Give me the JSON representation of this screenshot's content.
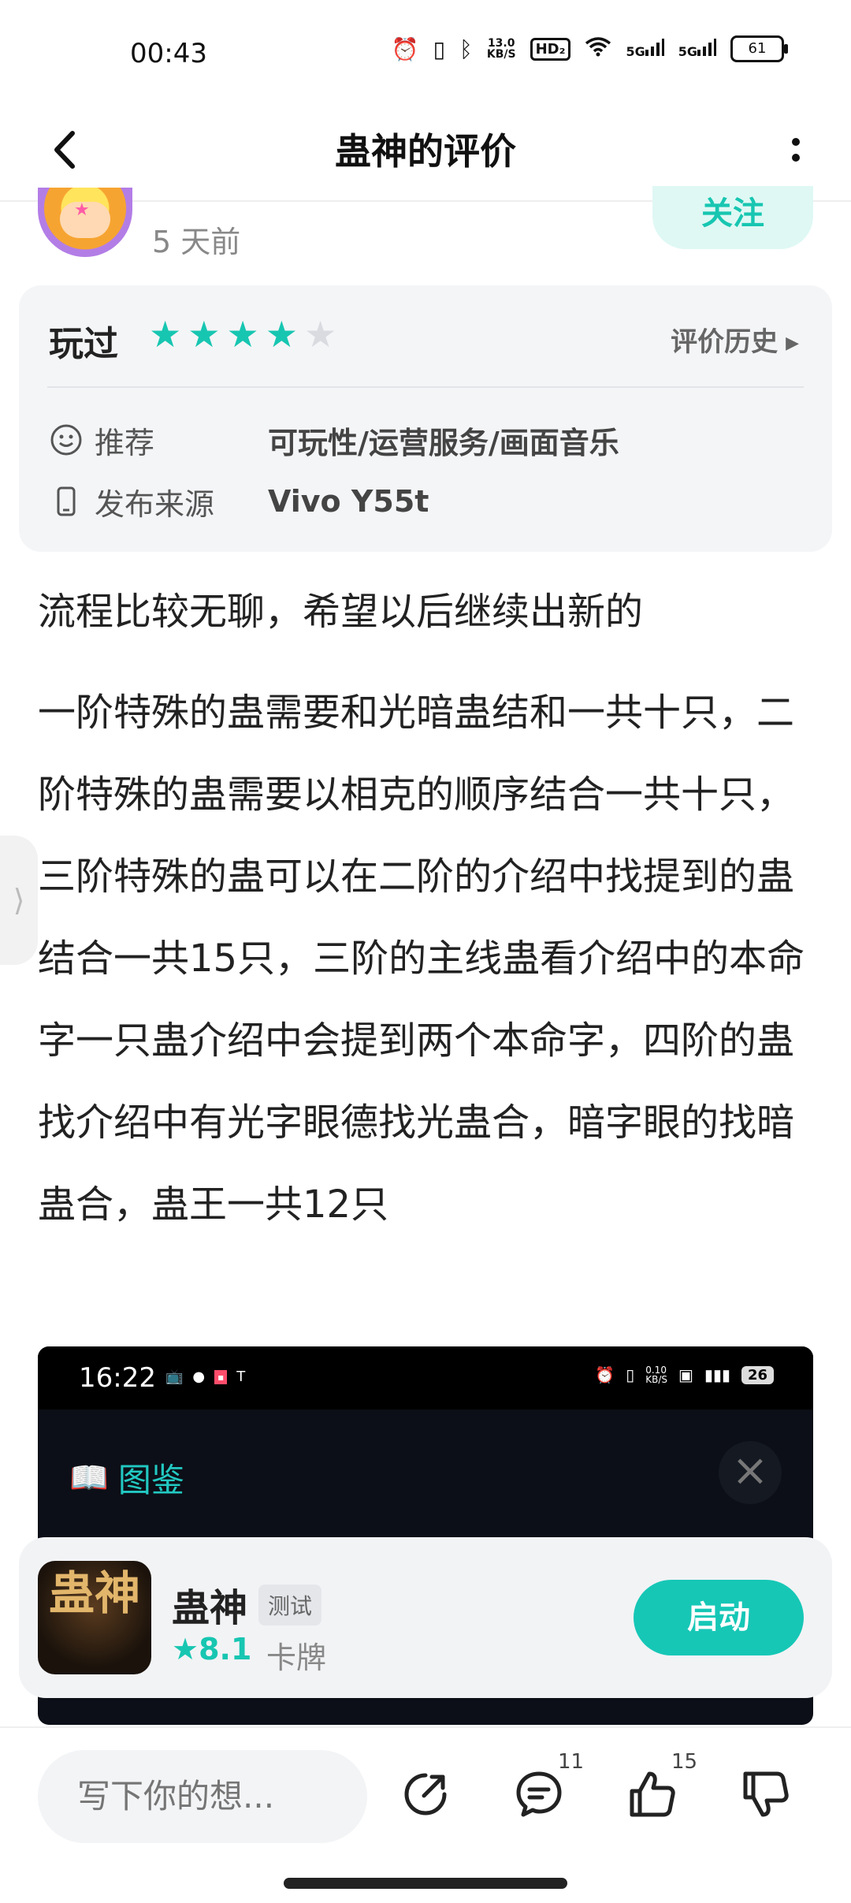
{
  "status_bar": {
    "time": "00:43",
    "net_speed": "13.0\nKB/S",
    "hd_badge": "HD₂",
    "signal1": "5G",
    "signal2": "5G",
    "battery": "61"
  },
  "header": {
    "title": "蛊神的评价"
  },
  "author": {
    "posted_time": "5 天前",
    "follow_label": "关注"
  },
  "rating": {
    "status_label": "玩过",
    "stars": 4,
    "max_stars": 5,
    "history_label": "评价历史",
    "recommend_label": "推荐",
    "recommend_value": "可玩性/运营服务/画面音乐",
    "source_label": "发布来源",
    "source_value": "Vivo Y55t"
  },
  "review": {
    "paragraph1": "流程比较无聊，希望以后继续出新的",
    "paragraph2": "一阶特殊的蛊需要和光暗蛊结和一共十只，二阶特殊的蛊需要以相克的顺序结合一共十只，三阶特殊的蛊可以在二阶的介绍中找提到的蛊结合一共15只，三阶的主线蛊看介绍中的本命字一只蛊介绍中会提到两个本命字，四阶的蛊找介绍中有光字眼德找光蛊合，暗字眼的找暗蛊合，蛊王一共12只"
  },
  "screenshot": {
    "time": "16:22",
    "title": "图鉴",
    "speed": "0.10\nKB/S",
    "battery": "26"
  },
  "game": {
    "icon_text": "蛊神",
    "name": "蛊神",
    "badge": "测试",
    "rating": "8.1",
    "genre": "卡牌",
    "launch_label": "启动"
  },
  "bottom_bar": {
    "input_placeholder": "写下你的想...",
    "comment_count": "11",
    "like_count": "15"
  },
  "colors": {
    "accent": "#17c6b1",
    "text": "#222222",
    "muted": "#888888"
  }
}
